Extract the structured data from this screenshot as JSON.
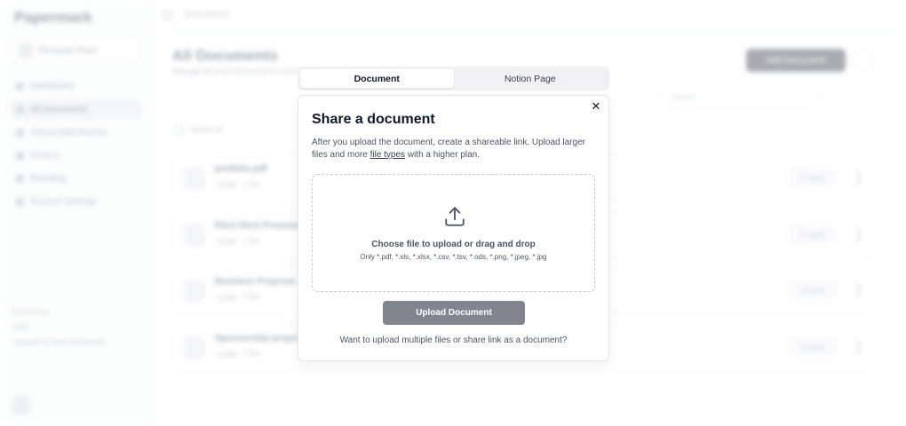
{
  "background": {
    "brand": "Papermark",
    "team_name": "Personal Team",
    "nav": [
      {
        "label": "Dashboard"
      },
      {
        "label": "All Documents"
      },
      {
        "label": "Virtual Data Rooms"
      },
      {
        "label": "Visitors"
      },
      {
        "label": "Branding"
      },
      {
        "label": "Account Settings"
      }
    ],
    "footer": [
      "Documents",
      "Links",
      "Upgrade for more documents"
    ],
    "breadcrumb": "Documents",
    "page_title": "All Documents",
    "page_subtitle": "Manage all your documents in one place.",
    "add_button": "Add Document",
    "search_placeholder": "Search...",
    "select_all": "Select all",
    "documents": [
      {
        "name": "portfolio.pdf",
        "meta": "1 page · 1 link",
        "views": "0 views"
      },
      {
        "name": "Pitch Deck Presentation",
        "meta": "1 page · 1 link",
        "views": "0 views"
      },
      {
        "name": "Business Proposal",
        "meta": "1 page · 1 link",
        "views": "0 views"
      },
      {
        "name": "Sponsorship proposal",
        "meta": "1 page · 1 link",
        "views": "0 views"
      }
    ]
  },
  "tabs": [
    {
      "label": "Document",
      "active": true
    },
    {
      "label": "Notion Page",
      "active": false
    }
  ],
  "modal": {
    "title": "Share a document",
    "description_before": "After you upload the document, create a shareable link. Upload larger files and more ",
    "description_link": "file types",
    "description_after": " with a higher plan.",
    "dropzone_title": "Choose file to upload or drag and drop",
    "dropzone_types": "Only *.pdf, *.xls, *.xlsx, *.csv, *.tsv, *.ods, *.png, *.jpeg, *.jpg",
    "upload_button": "Upload Document",
    "multi_link": "Want to upload multiple files or share link as a document?",
    "close_icon": "close-icon",
    "upload_icon": "upload-icon"
  },
  "colors": {
    "upload_button_bg": "#818590",
    "tab_active_bg": "#ffffff",
    "tab_track_bg": "#f1f1f3",
    "text_primary": "#0f172a",
    "text_secondary": "#4b5563"
  }
}
